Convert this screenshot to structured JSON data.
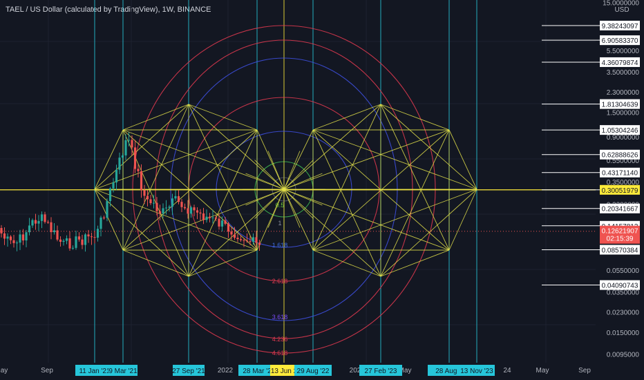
{
  "header": {
    "title": "TAEL / US Dollar (calculated by TradingView), 1W, BINANCE"
  },
  "colors": {
    "background": "#131722",
    "up": "#26a69a",
    "down": "#ef5350",
    "grid_line": "#26c6da",
    "date_line": "#ffeb3b",
    "star": "#e5e34a",
    "circle_red": "#e53950",
    "circle_blue": "#3f51e5",
    "circle_purple": "#7c4dff"
  },
  "chart_data": {
    "type": "candlestick",
    "symbol": "TAEL / US Dollar",
    "interval": "1W",
    "exchange": "BINANCE",
    "currency": "USD",
    "scale": "log",
    "y_ticks": [
      "15.0000000",
      "5.5000000",
      "3.5000000",
      "2.3000000",
      "1.5000000",
      "0.9000000",
      "0.5500000",
      "0.3500000",
      "0.2200000",
      "0.0550000",
      "0.0350000",
      "0.0230000",
      "0.0150000",
      "0.0095000"
    ],
    "price_labels": [
      {
        "text": "9.38243097",
        "value": 9.38243097,
        "style": "white"
      },
      {
        "text": "6.90583370",
        "value": 6.9058337,
        "style": "white"
      },
      {
        "text": "4.36079874",
        "value": 4.36079874,
        "style": "white"
      },
      {
        "text": "1.81304639",
        "value": 1.81304639,
        "style": "white"
      },
      {
        "text": "1.05304246",
        "value": 1.05304246,
        "style": "white"
      },
      {
        "text": "0.62888626",
        "value": 0.62888626,
        "style": "white"
      },
      {
        "text": "0.43171140",
        "value": 0.4317114,
        "style": "white"
      },
      {
        "text": "0.30051979",
        "value": 0.30051979,
        "style": "yellow"
      },
      {
        "text": "0.20341667",
        "value": 0.20341667,
        "style": "white"
      },
      {
        "text": "0.14157813",
        "value": 0.14157813,
        "style": "white"
      },
      {
        "text": "0.08570384",
        "value": 0.08570384,
        "style": "white"
      },
      {
        "text": "0.04090743",
        "value": 0.04090743,
        "style": "white"
      }
    ],
    "current_price": {
      "text": "0.12621907",
      "value": 0.12621907,
      "countdown": "02:15:39"
    },
    "x_ticks": [
      "ay",
      "Sep",
      "2022",
      "202",
      "May",
      "24",
      "May",
      "Sep"
    ],
    "date_labels": [
      {
        "text": "11 Jan '21",
        "style": "cyan"
      },
      {
        "text": "9 Mar '21",
        "style": "cyan"
      },
      {
        "text": "27 Sep '21",
        "style": "cyan"
      },
      {
        "text": "28 Mar '2",
        "style": "cyan"
      },
      {
        "text": "13 Jun 2",
        "style": "yellow"
      },
      {
        "text": "29 Aug '22",
        "style": "cyan"
      },
      {
        "text": "27 Feb '23",
        "style": "cyan"
      },
      {
        "text": "28 Aug 2",
        "style": "cyan"
      },
      {
        "text": "13 Nov '23",
        "style": "cyan"
      }
    ],
    "fib_labels": [
      {
        "text": "0.5",
        "color": "#6fcf3a"
      },
      {
        "text": "1",
        "color": "#8a8f9c"
      },
      {
        "text": "1.618",
        "color": "#3f6fe5"
      },
      {
        "text": "2.618",
        "color": "#e53950"
      },
      {
        "text": "3.618",
        "color": "#7c4dff"
      },
      {
        "text": "4.236",
        "color": "#e53950"
      },
      {
        "text": "4.618",
        "color": "#e53950"
      }
    ]
  }
}
